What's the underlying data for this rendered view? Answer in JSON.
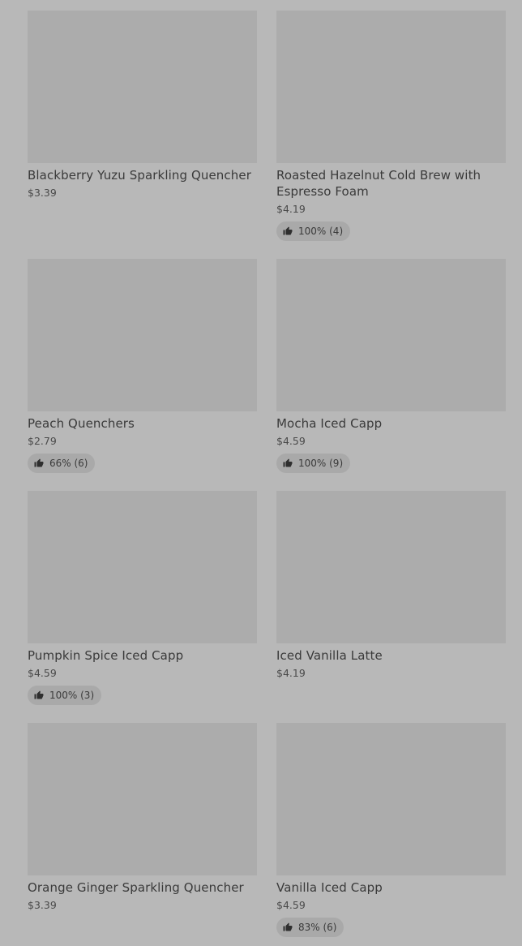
{
  "products": [
    {
      "name": "Blackberry Yuzu Sparkling Quencher",
      "price": "$3.39",
      "rating": ""
    },
    {
      "name": "Roasted Hazelnut Cold Brew with Espresso Foam",
      "price": "$4.19",
      "rating": "100% (4)"
    },
    {
      "name": "Peach Quenchers",
      "price": "$2.79",
      "rating": "66% (6)"
    },
    {
      "name": "Mocha Iced Capp",
      "price": "$4.59",
      "rating": "100% (9)"
    },
    {
      "name": "Pumpkin Spice Iced Capp",
      "price": "$4.59",
      "rating": "100% (3)"
    },
    {
      "name": "Iced Vanilla Latte",
      "price": "$4.19",
      "rating": ""
    },
    {
      "name": "Orange Ginger Sparkling Quencher",
      "price": "$3.39",
      "rating": ""
    },
    {
      "name": "Vanilla Iced Capp",
      "price": "$4.59",
      "rating": "83% (6)"
    }
  ],
  "icons": {
    "rating": "thumbs-up-icon"
  }
}
